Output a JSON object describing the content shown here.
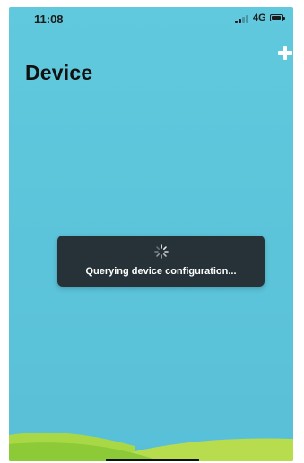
{
  "status_bar": {
    "time": "11:08",
    "network": "4G",
    "signal_bars": 2,
    "signal_total": 4
  },
  "header": {
    "title": "Device",
    "add_icon": "plus-icon"
  },
  "toast": {
    "message": "Querying device configuration...",
    "icon": "loading-spinner-icon"
  },
  "colors": {
    "background": "#5ec6db",
    "toast": "#263238",
    "hill_front": "#8fcc3b",
    "hill_back": "#b6dc4a"
  }
}
